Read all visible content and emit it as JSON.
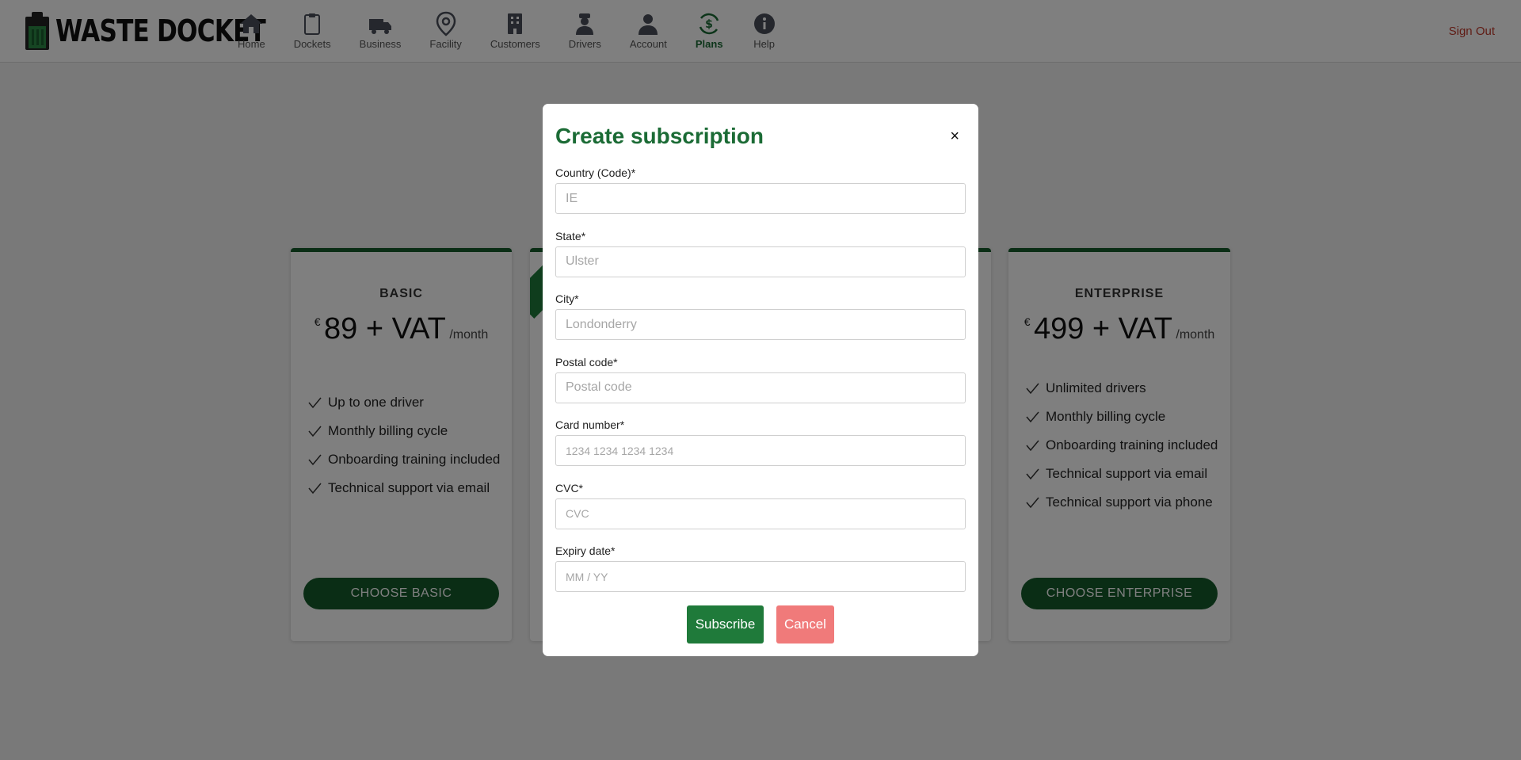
{
  "brand": {
    "name": "WASTE DOCKET"
  },
  "nav": {
    "items": [
      {
        "label": "Home",
        "icon": "home-icon"
      },
      {
        "label": "Dockets",
        "icon": "clipboard-icon"
      },
      {
        "label": "Business",
        "icon": "truck-icon"
      },
      {
        "label": "Facility",
        "icon": "location-pin-icon"
      },
      {
        "label": "Customers",
        "icon": "building-icon"
      },
      {
        "label": "Drivers",
        "icon": "driver-icon"
      },
      {
        "label": "Account",
        "icon": "person-icon"
      },
      {
        "label": "Plans",
        "icon": "dollar-cycle-icon",
        "active": true
      },
      {
        "label": "Help",
        "icon": "info-icon"
      }
    ],
    "sign_out": "Sign Out"
  },
  "plans": {
    "basic": {
      "name": "BASIC",
      "currency": "€",
      "price": "89 + VAT",
      "period": "/month",
      "features": [
        "Up to one driver",
        "Monthly billing cycle",
        "Onboarding training included",
        "Technical support via email"
      ],
      "button": "CHOOSE BASIC"
    },
    "enterprise": {
      "name": "ENTERPRISE",
      "currency": "€",
      "price": "499 + VAT",
      "period": "/month",
      "features": [
        "Unlimited drivers",
        "Monthly billing cycle",
        "Onboarding training included",
        "Technical support via email",
        "Technical support via phone"
      ],
      "button": "CHOOSE ENTERPRISE"
    }
  },
  "modal": {
    "title": "Create subscription",
    "close": "×",
    "fields": {
      "country": {
        "label": "Country (Code)*",
        "placeholder": "IE"
      },
      "state": {
        "label": "State*",
        "placeholder": "Ulster"
      },
      "city": {
        "label": "City*",
        "placeholder": "Londonderry"
      },
      "postal": {
        "label": "Postal code*",
        "placeholder": "Postal code"
      },
      "card": {
        "label": "Card number*",
        "placeholder": "1234 1234 1234 1234"
      },
      "cvc": {
        "label": "CVC*",
        "placeholder": "CVC"
      },
      "expiry": {
        "label": "Expiry date*",
        "placeholder": "MM / YY"
      }
    },
    "subscribe": "Subscribe",
    "cancel": "Cancel"
  },
  "colors": {
    "brand_green": "#1b6b35",
    "dark_green": "#145a2b",
    "cancel_red": "#f07a7a",
    "signout_red": "#c0392b"
  }
}
